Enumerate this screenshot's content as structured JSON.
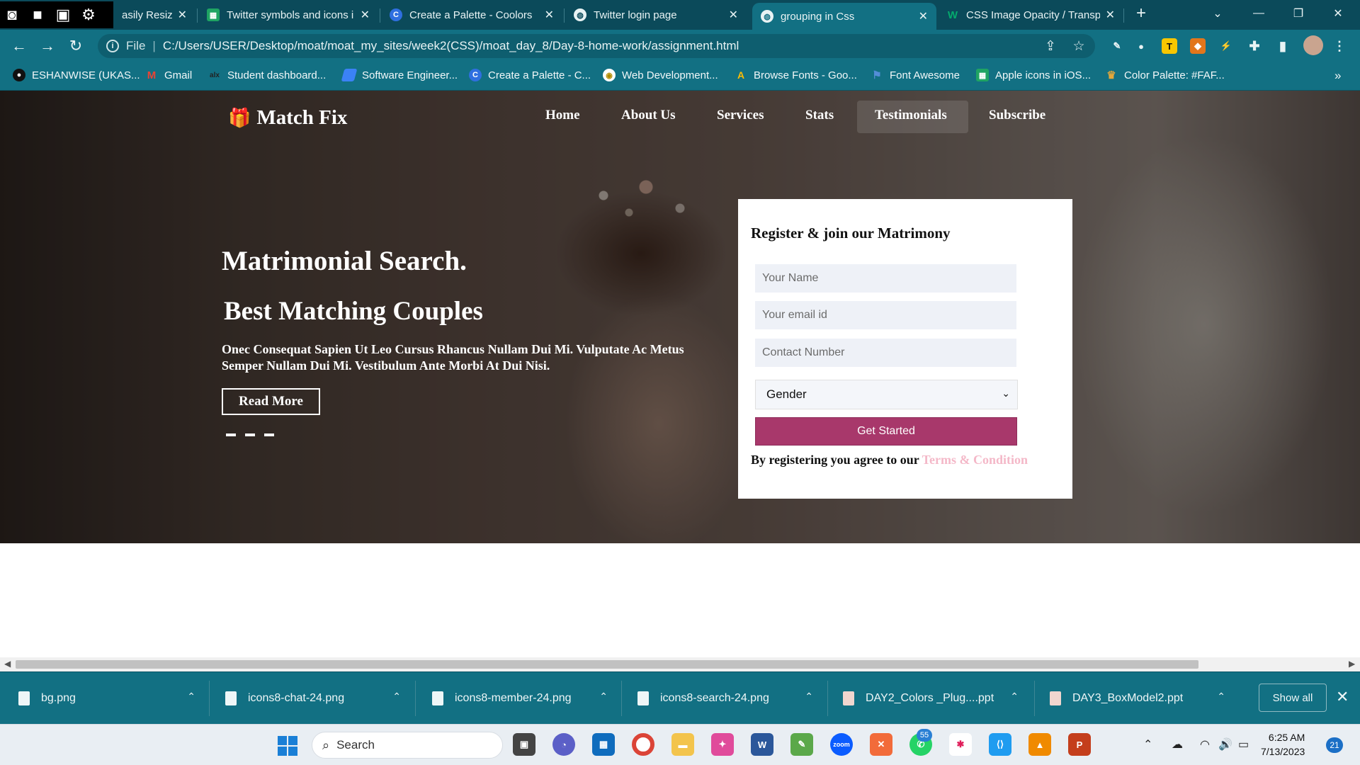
{
  "browser": {
    "tabs": [
      {
        "label": "asily Resize",
        "favicon_color": "#0b4a5a"
      },
      {
        "label": "Twitter symbols and icons i",
        "favicon_color": "#1fa463"
      },
      {
        "label": "Create a Palette - Coolors",
        "favicon_color": "#2f6fe0"
      },
      {
        "label": "Twitter login page",
        "favicon_color": "#ffffff"
      },
      {
        "label": "grouping in Css",
        "favicon_color": "#ffffff"
      },
      {
        "label": "CSS Image Opacity / Transp",
        "favicon_color": "#04aa6d"
      }
    ],
    "new_tab": "+",
    "address": {
      "scheme": "File",
      "url": "C:/Users/USER/Desktop/moat/moat_my_sites/week2(CSS)/moat_day_8/Day-8-home-work/assignment.html"
    },
    "bookmarks": [
      {
        "label": "ESHANWISE (UKAS...",
        "icon_color": "#111111"
      },
      {
        "label": "Gmail",
        "icon_color": "#ea4335"
      },
      {
        "label": "Student dashboard...",
        "icon_color": "#333333"
      },
      {
        "label": "Software Engineer...",
        "icon_color": "#3b82f6"
      },
      {
        "label": "Create a Palette - C...",
        "icon_color": "#2f6fe0"
      },
      {
        "label": "Web Development...",
        "icon_color": "#f5c542"
      },
      {
        "label": "Browse Fonts - Goo...",
        "icon_color": "#fbbc05"
      },
      {
        "label": "Font Awesome",
        "icon_color": "#538dd7"
      },
      {
        "label": "Apple icons in iOS...",
        "icon_color": "#1fa463"
      },
      {
        "label": "Color Palette: #FAF...",
        "icon_color": "#e2a73b"
      }
    ],
    "bookmarks_overflow": "»"
  },
  "site": {
    "brand": "Match Fix",
    "nav": [
      "Home",
      "About Us",
      "Services",
      "Stats",
      "Testimonials",
      "Subscribe"
    ],
    "hero": {
      "title": "Matrimonial Search.",
      "subtitle": "Best Matching Couples",
      "text": "Onec Consequat Sapien Ut Leo Cursus Rhancus Nullam Dui Mi. Vulputate Ac Metus Semper Nullam Dui Mi. Vestibulum Ante Morbi At Dui Nisi.",
      "button": "Read More"
    },
    "register": {
      "title": "Register & join our Matrimony",
      "name_placeholder": "Your Name",
      "email_placeholder": "Your email id",
      "contact_placeholder": "Contact Number",
      "gender_selected": "Gender",
      "submit": "Get Started",
      "terms_prefix": "By registering you agree to our",
      "terms_link": "Terms & Condition"
    },
    "colors": {
      "accent": "#a8386b",
      "terms_link": "#f4b8c8"
    }
  },
  "downloads": {
    "items": [
      {
        "label": "bg.png"
      },
      {
        "label": "icons8-chat-24.png"
      },
      {
        "label": "icons8-member-24.png"
      },
      {
        "label": "icons8-search-24.png"
      },
      {
        "label": "DAY2_Colors _Plug....ppt"
      },
      {
        "label": "DAY3_BoxModel2.ppt"
      }
    ],
    "show_all": "Show all"
  },
  "taskbar": {
    "search": "Search",
    "whatsapp_badge": "55",
    "time": "6:25 AM",
    "date": "7/13/2023",
    "notifications": "21"
  }
}
